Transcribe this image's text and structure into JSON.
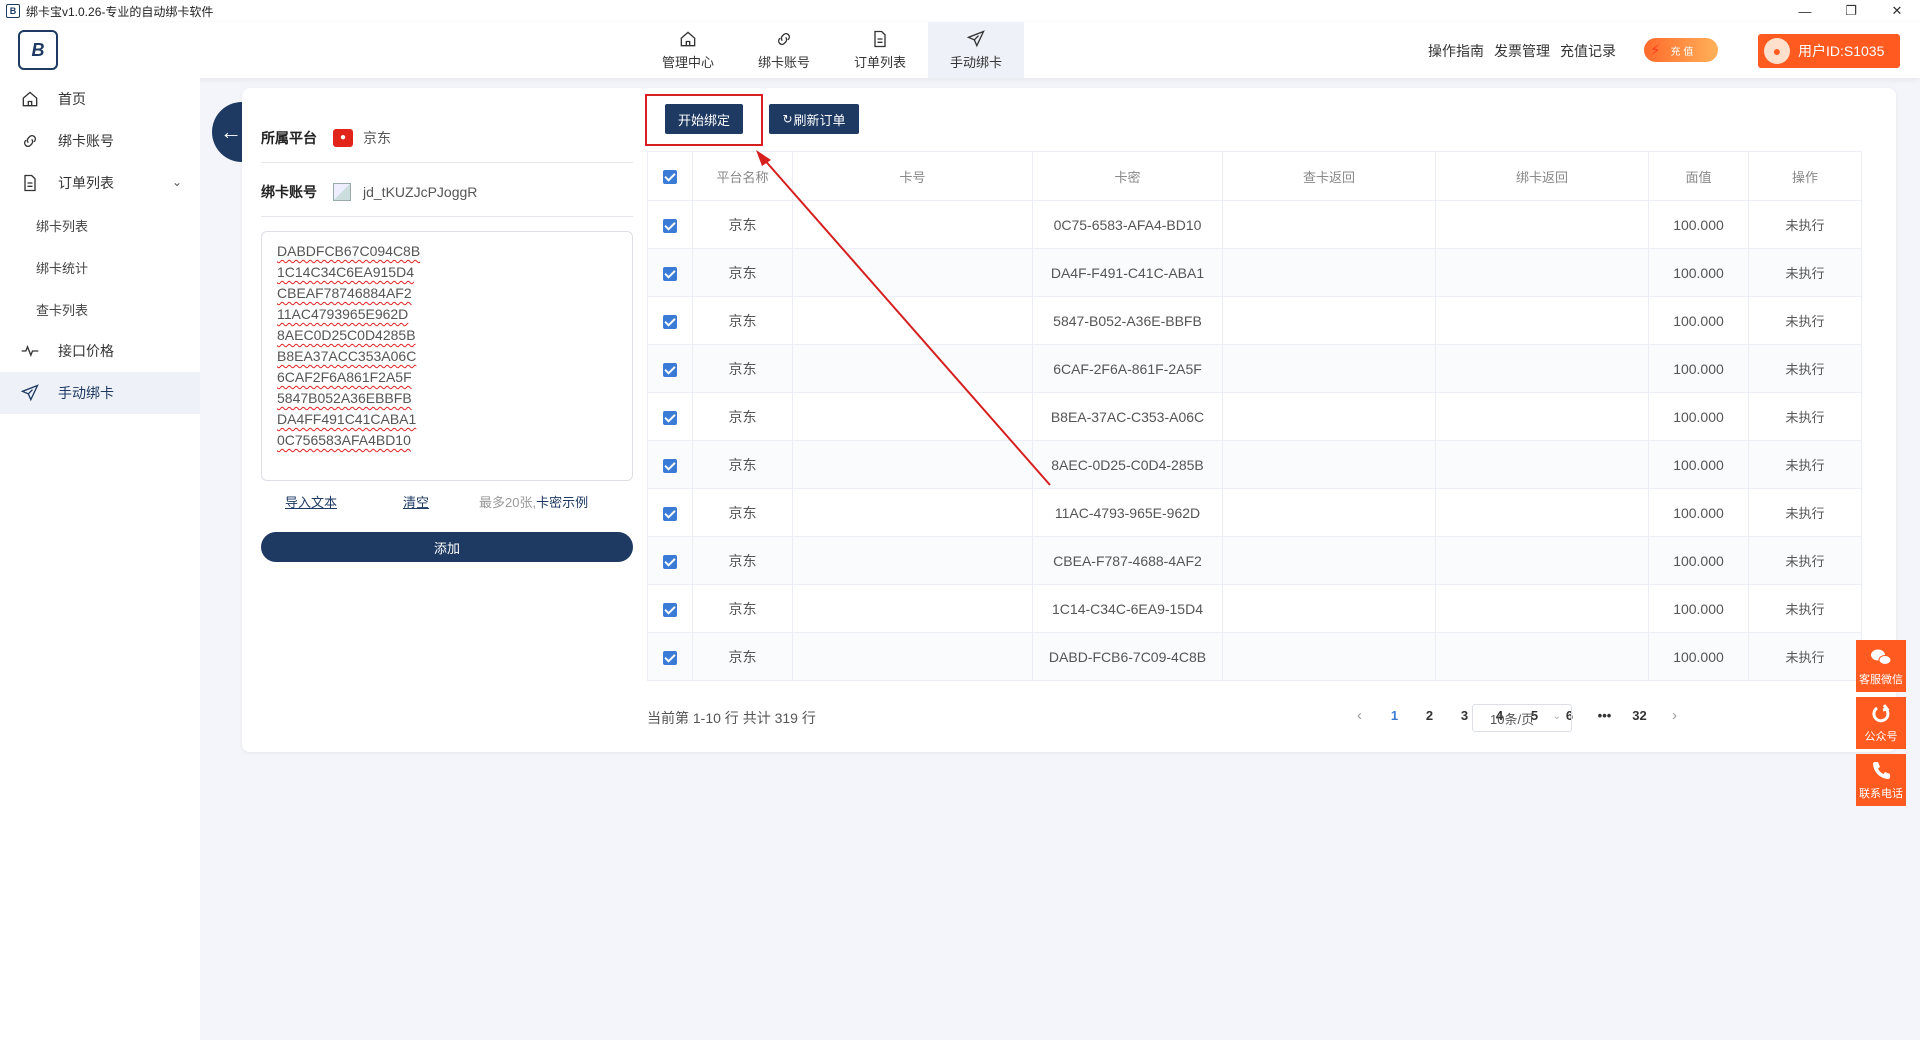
{
  "window": {
    "title": "绑卡宝v1.0.26-专业的自动绑卡软件",
    "controls": [
      "—",
      "❐",
      "✕"
    ]
  },
  "logo": {
    "text": "B"
  },
  "topnav": {
    "items": [
      {
        "label": "管理中心",
        "icon": "home-icon"
      },
      {
        "label": "绑卡账号",
        "icon": "link-icon"
      },
      {
        "label": "订单列表",
        "icon": "document-icon"
      },
      {
        "label": "手动绑卡",
        "icon": "send-icon",
        "active": true
      }
    ]
  },
  "header": {
    "links": [
      "操作指南",
      "发票管理",
      "充值记录"
    ],
    "recharge_label": "充 值",
    "user_label": "用户ID:S1035"
  },
  "sidebar": {
    "items": [
      {
        "label": "首页",
        "icon": "home-icon"
      },
      {
        "label": "绑卡账号",
        "icon": "link-icon"
      },
      {
        "label": "订单列表",
        "icon": "document-icon"
      }
    ],
    "subitems": [
      "绑卡列表",
      "绑卡统计",
      "查卡列表"
    ],
    "bottom_items": [
      {
        "label": "接口价格",
        "icon": "pulse-icon"
      },
      {
        "label": "手动绑卡",
        "icon": "send-icon",
        "active": true
      }
    ]
  },
  "form": {
    "platform_label": "所属平台",
    "platform_value": "京东",
    "account_label": "绑卡账号",
    "account_value": "jd_tKUZJcPJoggR",
    "card_lines": [
      "DABDFCB67C094C8B",
      "1C14C34C6EA915D4",
      "CBEAF78746884AF2",
      "11AC4793965E962D",
      "8AEC0D25C0D4285B",
      "B8EA37ACC353A06C",
      "6CAF2F6A861F2A5F",
      "5847B052A36EBBFB",
      "DA4FF491C41CABA1",
      "0C756583AFA4BD10"
    ],
    "import_label": "导入文本",
    "clear_label": "清空",
    "limit_hint": "最多20张,",
    "example_label": "卡密示例",
    "add_label": "添加"
  },
  "toolbar": {
    "start_label": "开始绑定",
    "refresh_label": "刷新订单"
  },
  "table": {
    "headers": [
      "平台名称",
      "卡号",
      "卡密",
      "查卡返回",
      "绑卡返回",
      "面值",
      "操作"
    ],
    "rows": [
      {
        "platform": "京东",
        "card_no": "",
        "card_pwd": "0C75-6583-AFA4-BD10",
        "check": "",
        "bind": "",
        "value": "100.000",
        "op": "未执行"
      },
      {
        "platform": "京东",
        "card_no": "",
        "card_pwd": "DA4F-F491-C41C-ABA1",
        "check": "",
        "bind": "",
        "value": "100.000",
        "op": "未执行"
      },
      {
        "platform": "京东",
        "card_no": "",
        "card_pwd": "5847-B052-A36E-BBFB",
        "check": "",
        "bind": "",
        "value": "100.000",
        "op": "未执行"
      },
      {
        "platform": "京东",
        "card_no": "",
        "card_pwd": "6CAF-2F6A-861F-2A5F",
        "check": "",
        "bind": "",
        "value": "100.000",
        "op": "未执行"
      },
      {
        "platform": "京东",
        "card_no": "",
        "card_pwd": "B8EA-37AC-C353-A06C",
        "check": "",
        "bind": "",
        "value": "100.000",
        "op": "未执行"
      },
      {
        "platform": "京东",
        "card_no": "",
        "card_pwd": "8AEC-0D25-C0D4-285B",
        "check": "",
        "bind": "",
        "value": "100.000",
        "op": "未执行"
      },
      {
        "platform": "京东",
        "card_no": "",
        "card_pwd": "11AC-4793-965E-962D",
        "check": "",
        "bind": "",
        "value": "100.000",
        "op": "未执行"
      },
      {
        "platform": "京东",
        "card_no": "",
        "card_pwd": "CBEA-F787-4688-4AF2",
        "check": "",
        "bind": "",
        "value": "100.000",
        "op": "未执行"
      },
      {
        "platform": "京东",
        "card_no": "",
        "card_pwd": "1C14-C34C-6EA9-15D4",
        "check": "",
        "bind": "",
        "value": "100.000",
        "op": "未执行"
      },
      {
        "platform": "京东",
        "card_no": "",
        "card_pwd": "DABD-FCB6-7C09-4C8B",
        "check": "",
        "bind": "",
        "value": "100.000",
        "op": "未执行"
      }
    ]
  },
  "pagination": {
    "summary": "当前第 1-10 行  共计 319 行",
    "pages": [
      "1",
      "2",
      "3",
      "4",
      "5",
      "6",
      "•••",
      "32"
    ],
    "current": "1",
    "page_size": "10条/页"
  },
  "float_buttons": [
    {
      "label": "客服微信",
      "icon": "wechat-icon"
    },
    {
      "label": "公众号",
      "icon": "official-account-icon"
    },
    {
      "label": "联系电话",
      "icon": "phone-icon"
    }
  ],
  "colors": {
    "brand": "#1e3a63",
    "accent": "#ff5a1f",
    "annotation": "#d61f1f",
    "checkbox": "#3a7bd5"
  }
}
